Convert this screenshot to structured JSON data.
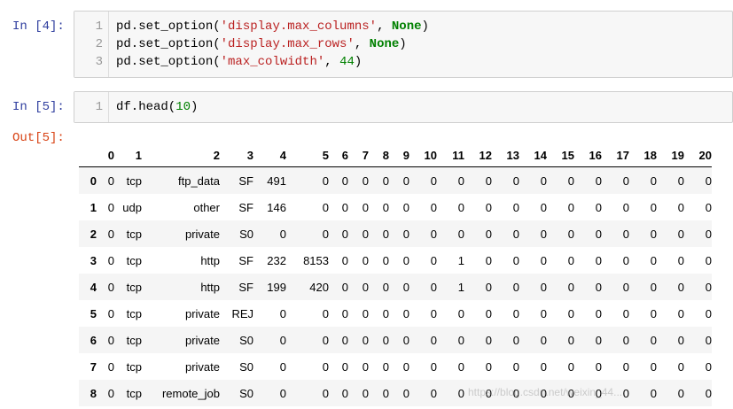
{
  "cells": {
    "in4": {
      "prompt": "In [4]:",
      "line_numbers": [
        "1",
        "2",
        "3"
      ],
      "lines": [
        {
          "fn": "pd.set_option(",
          "q1": "'",
          "str": "display.max_columns",
          "q2": "'",
          "sep": ", ",
          "arg": "None",
          "close": ")"
        },
        {
          "fn": "pd.set_option(",
          "q1": "'",
          "str": "display.max_rows",
          "q2": "'",
          "sep": ", ",
          "arg": "None",
          "close": ")"
        },
        {
          "fn": "pd.set_option(",
          "q1": "'",
          "str": "max_colwidth",
          "q2": "'",
          "sep": ", ",
          "arg": "44",
          "close": ")"
        }
      ]
    },
    "in5": {
      "prompt": "In [5]:",
      "line_number": "1",
      "code_fn": "df.head(",
      "code_arg": "10",
      "code_close": ")"
    },
    "out5": {
      "prompt": "Out[5]:"
    }
  },
  "table": {
    "columns": [
      "0",
      "1",
      "2",
      "3",
      "4",
      "5",
      "6",
      "7",
      "8",
      "9",
      "10",
      "11",
      "12",
      "13",
      "14",
      "15",
      "16",
      "17",
      "18",
      "19",
      "20"
    ],
    "rows": [
      {
        "index": "0",
        "values": [
          "0",
          "tcp",
          "ftp_data",
          "SF",
          "491",
          "0",
          "0",
          "0",
          "0",
          "0",
          "0",
          "0",
          "0",
          "0",
          "0",
          "0",
          "0",
          "0",
          "0",
          "0",
          "0"
        ]
      },
      {
        "index": "1",
        "values": [
          "0",
          "udp",
          "other",
          "SF",
          "146",
          "0",
          "0",
          "0",
          "0",
          "0",
          "0",
          "0",
          "0",
          "0",
          "0",
          "0",
          "0",
          "0",
          "0",
          "0",
          "0"
        ]
      },
      {
        "index": "2",
        "values": [
          "0",
          "tcp",
          "private",
          "S0",
          "0",
          "0",
          "0",
          "0",
          "0",
          "0",
          "0",
          "0",
          "0",
          "0",
          "0",
          "0",
          "0",
          "0",
          "0",
          "0",
          "0"
        ]
      },
      {
        "index": "3",
        "values": [
          "0",
          "tcp",
          "http",
          "SF",
          "232",
          "8153",
          "0",
          "0",
          "0",
          "0",
          "0",
          "1",
          "0",
          "0",
          "0",
          "0",
          "0",
          "0",
          "0",
          "0",
          "0"
        ]
      },
      {
        "index": "4",
        "values": [
          "0",
          "tcp",
          "http",
          "SF",
          "199",
          "420",
          "0",
          "0",
          "0",
          "0",
          "0",
          "1",
          "0",
          "0",
          "0",
          "0",
          "0",
          "0",
          "0",
          "0",
          "0"
        ]
      },
      {
        "index": "5",
        "values": [
          "0",
          "tcp",
          "private",
          "REJ",
          "0",
          "0",
          "0",
          "0",
          "0",
          "0",
          "0",
          "0",
          "0",
          "0",
          "0",
          "0",
          "0",
          "0",
          "0",
          "0",
          "0"
        ]
      },
      {
        "index": "6",
        "values": [
          "0",
          "tcp",
          "private",
          "S0",
          "0",
          "0",
          "0",
          "0",
          "0",
          "0",
          "0",
          "0",
          "0",
          "0",
          "0",
          "0",
          "0",
          "0",
          "0",
          "0",
          "0"
        ]
      },
      {
        "index": "7",
        "values": [
          "0",
          "tcp",
          "private",
          "S0",
          "0",
          "0",
          "0",
          "0",
          "0",
          "0",
          "0",
          "0",
          "0",
          "0",
          "0",
          "0",
          "0",
          "0",
          "0",
          "0",
          "0"
        ]
      },
      {
        "index": "8",
        "values": [
          "0",
          "tcp",
          "remote_job",
          "S0",
          "0",
          "0",
          "0",
          "0",
          "0",
          "0",
          "0",
          "0",
          "0",
          "0",
          "0",
          "0",
          "0",
          "0",
          "0",
          "0",
          "0"
        ]
      }
    ]
  },
  "watermark": "https://blog.csdn.net/weixin_44...",
  "colors": {
    "prompt_in": "#303f9f",
    "prompt_out": "#d84315",
    "string": "#ba2121",
    "keyword": "#008000",
    "cell_background": "#f7f7f7"
  }
}
